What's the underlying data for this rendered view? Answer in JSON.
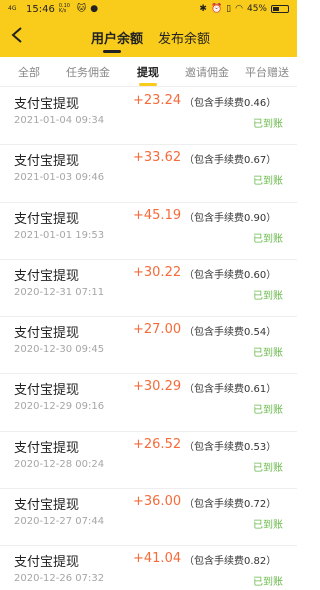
{
  "status_bar": {
    "signal": "4G",
    "time": "15:46",
    "speed": "0.10 K/s",
    "battery": "45%",
    "battery_level": 0.45
  },
  "nav": {
    "tabs": [
      {
        "label": "用户余额",
        "active": true
      },
      {
        "label": "发布余额",
        "active": false
      }
    ]
  },
  "subtabs": [
    {
      "label": "全部",
      "active": false
    },
    {
      "label": "任务佣金",
      "active": false
    },
    {
      "label": "提现",
      "active": true
    },
    {
      "label": "邀请佣金",
      "active": false
    },
    {
      "label": "平台赠送",
      "active": false
    }
  ],
  "records": [
    {
      "title": "支付宝提现",
      "date": "2021-01-04 09:34",
      "amount": "+23.24",
      "fee": "（包含手续费0.46）",
      "status": "已到账"
    },
    {
      "title": "支付宝提现",
      "date": "2021-01-03 09:46",
      "amount": "+33.62",
      "fee": "（包含手续费0.67）",
      "status": "已到账"
    },
    {
      "title": "支付宝提现",
      "date": "2021-01-01 19:53",
      "amount": "+45.19",
      "fee": "（包含手续费0.90）",
      "status": "已到账"
    },
    {
      "title": "支付宝提现",
      "date": "2020-12-31 07:11",
      "amount": "+30.22",
      "fee": "（包含手续费0.60）",
      "status": "已到账"
    },
    {
      "title": "支付宝提现",
      "date": "2020-12-30 09:45",
      "amount": "+27.00",
      "fee": "（包含手续费0.54）",
      "status": "已到账"
    },
    {
      "title": "支付宝提现",
      "date": "2020-12-29 09:16",
      "amount": "+30.29",
      "fee": "（包含手续费0.61）",
      "status": "已到账"
    },
    {
      "title": "支付宝提现",
      "date": "2020-12-28 00:24",
      "amount": "+26.52",
      "fee": "（包含手续费0.53）",
      "status": "已到账"
    },
    {
      "title": "支付宝提现",
      "date": "2020-12-27 07:44",
      "amount": "+36.00",
      "fee": "（包含手续费0.72）",
      "status": "已到账"
    },
    {
      "title": "支付宝提现",
      "date": "2020-12-26 07:32",
      "amount": "+41.04",
      "fee": "（包含手续费0.82）",
      "status": "已到账"
    }
  ],
  "colors": {
    "header": "#f9cc1c",
    "amount": "#f56b3a",
    "status": "#6ab94c"
  }
}
